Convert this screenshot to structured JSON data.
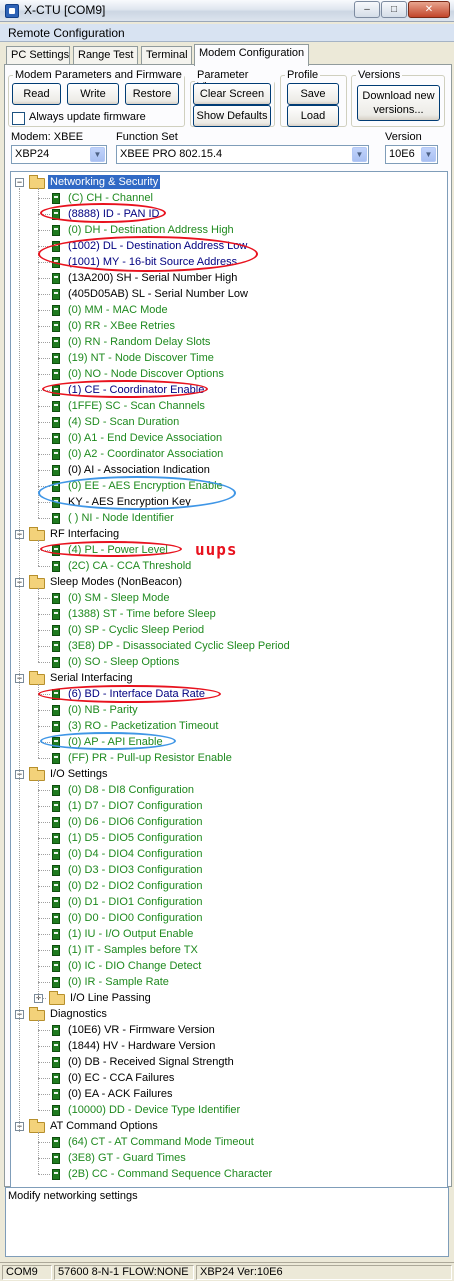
{
  "window": {
    "title": "X-CTU  [COM9]"
  },
  "remote_config": {
    "label": "Remote Configuration"
  },
  "tabs": [
    "PC Settings",
    "Range Test",
    "Terminal",
    "Modem Configuration"
  ],
  "modem_params": {
    "legend": "Modem Parameters and Firmware",
    "read": "Read",
    "write": "Write",
    "restore": "Restore",
    "always_update": "Always update firmware"
  },
  "param_view": {
    "legend": "Parameter View",
    "clear_screen": "Clear Screen",
    "show_defaults": "Show Defaults"
  },
  "profile": {
    "legend": "Profile",
    "save": "Save",
    "load": "Load"
  },
  "versions": {
    "legend": "Versions",
    "download": "Download new versions..."
  },
  "selectors": {
    "modem_label": "Modem: XBEE",
    "modem_value": "XBP24",
    "function_label": "Function Set",
    "function_value": "XBEE PRO 802.15.4",
    "version_label": "Version",
    "version_value": "10E6"
  },
  "tree": {
    "networking": {
      "label": "Networking & Security",
      "items": [
        "(C) CH - Channel",
        "(8888) ID - PAN ID",
        "(0) DH - Destination Address High",
        "(1002) DL - Destination Address Low",
        "(1001) MY - 16-bit Source Address",
        "(13A200) SH - Serial Number High",
        "(405D05AB) SL - Serial Number Low",
        "(0) MM - MAC Mode",
        "(0) RR - XBee Retries",
        "(0) RN - Random Delay Slots",
        "(19) NT - Node Discover Time",
        "(0) NO - Node Discover Options",
        "(1) CE - Coordinator Enable",
        "(1FFE) SC - Scan Channels",
        "(4) SD - Scan Duration",
        "(0) A1 - End Device Association",
        "(0) A2 - Coordinator Association",
        "(0) AI - Association Indication",
        "(0) EE - AES Encryption Enable",
        "KY - AES Encryption Key",
        "( ) NI - Node Identifier"
      ]
    },
    "rf": {
      "label": "RF Interfacing",
      "items": [
        "(4) PL - Power Level",
        "(2C) CA - CCA Threshold"
      ]
    },
    "sleep": {
      "label": "Sleep Modes (NonBeacon)",
      "items": [
        "(0) SM - Sleep Mode",
        "(1388) ST - Time before Sleep",
        "(0) SP - Cyclic Sleep Period",
        "(3E8) DP - Disassociated Cyclic Sleep Period",
        "(0) SO - Sleep Options"
      ]
    },
    "serial": {
      "label": "Serial Interfacing",
      "items": [
        "(6) BD - Interface Data Rate",
        "(0) NB - Parity",
        "(3) RO - Packetization Timeout",
        "(0) AP - API Enable",
        "(FF) PR - Pull-up Resistor Enable"
      ]
    },
    "io": {
      "label": "I/O Settings",
      "items": [
        "(0) D8 - DI8 Configuration",
        "(1) D7 - DIO7 Configuration",
        "(0) D6 - DIO6 Configuration",
        "(1) D5 - DIO5 Configuration",
        "(0) D4 - DIO4 Configuration",
        "(0) D3 - DIO3 Configuration",
        "(0) D2 - DIO2 Configuration",
        "(0) D1 - DIO1 Configuration",
        "(0) D0 - DIO0 Configuration",
        "(1) IU - I/O Output Enable",
        "(1) IT - Samples before TX",
        "(0) IC - DIO Change Detect",
        "(0) IR - Sample Rate"
      ],
      "sub": "I/O Line Passing"
    },
    "diag": {
      "label": "Diagnostics",
      "items": [
        "(10E6) VR - Firmware Version",
        "(1844) HV - Hardware Version",
        "(0) DB - Received Signal Strength",
        "(0) EC - CCA Failures",
        "(0) EA - ACK Failures",
        "(10000) DD - Device Type Identifier"
      ]
    },
    "at": {
      "label": "AT Command Options",
      "items": [
        "(64) CT - AT Command Mode Timeout",
        "(3E8) GT - Guard Times",
        "(2B) CC - Command Sequence Character"
      ]
    }
  },
  "annotation": {
    "text": "uups",
    "color": "#e8121e"
  },
  "hint": "Modify networking settings",
  "status": {
    "port": "COM9",
    "settings": "57600 8-N-1  FLOW:NONE",
    "device": "XBP24  Ver:10E6"
  },
  "colors": {
    "selected": "#316ac5",
    "green_text": "#1f8a1f",
    "navy_text": "#000080",
    "ring_red": "#e8121e",
    "ring_blue": "#3f96e6"
  }
}
